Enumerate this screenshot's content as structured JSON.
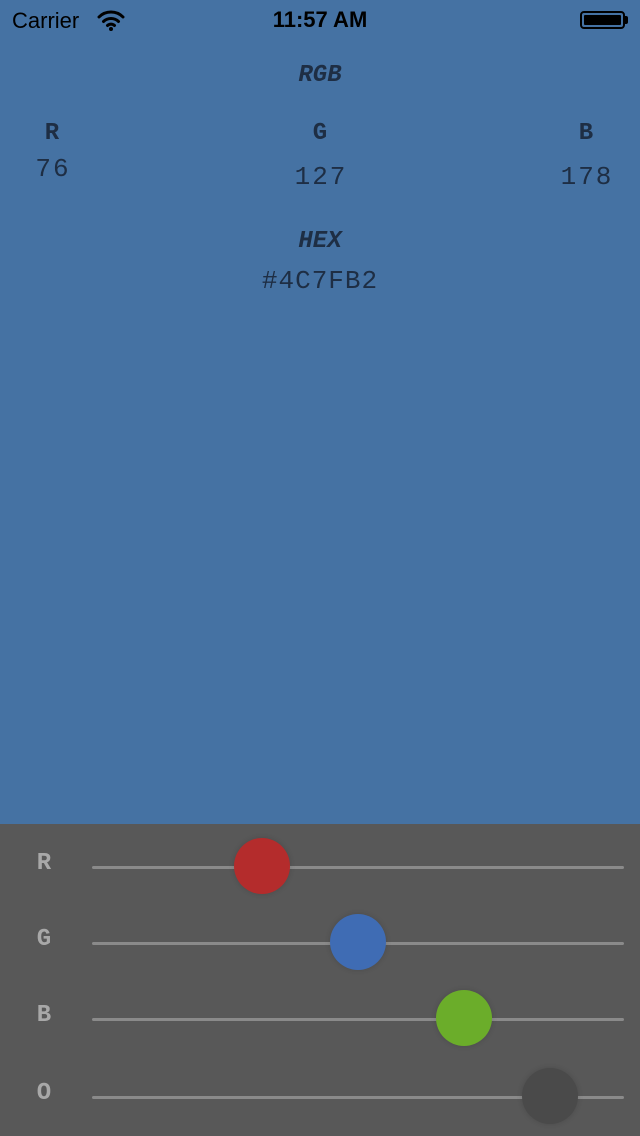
{
  "status_bar": {
    "carrier": "Carrier",
    "time": "11:57 AM",
    "icons": [
      "wifi-icon",
      "battery-icon"
    ]
  },
  "display": {
    "background_color": "#4572A3",
    "rgb_heading": "RGB",
    "channels": [
      {
        "label": "R",
        "value": "76"
      },
      {
        "label": "G",
        "value": "127"
      },
      {
        "label": "B",
        "value": "178"
      }
    ],
    "hex_heading": "HEX",
    "hex_value": "#4C7FB2"
  },
  "sliders": [
    {
      "label": "R",
      "value": 0.32,
      "thumb_color": "#B42C2C"
    },
    {
      "label": "G",
      "value": 0.5,
      "thumb_color": "#3F6CB4"
    },
    {
      "label": "B",
      "value": 0.7,
      "thumb_color": "#6BAD2A"
    },
    {
      "label": "O",
      "value": 0.86,
      "thumb_color": "#4A4A4A"
    }
  ]
}
